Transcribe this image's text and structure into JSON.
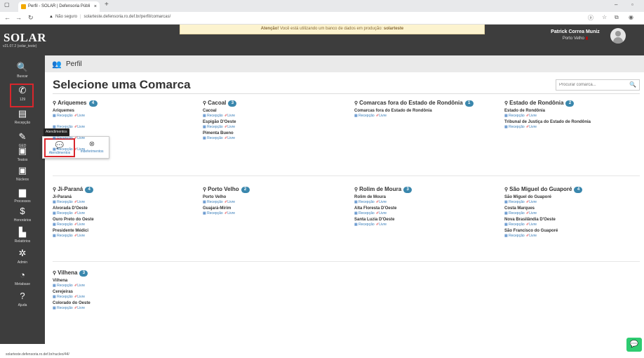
{
  "browser": {
    "tab_title": "Perfil - SOLAR | Defensoria Públi",
    "tab_close": "×",
    "new_tab": "+",
    "security_label": "Não seguro",
    "url": "solarteste.defensoria.ro.def.br/perfil/comarcas/",
    "status_url": "solarteste.defensoria.ro.def.br/nucleo/44/"
  },
  "app": {
    "logo": "SOLAR",
    "version": "v21.07.2 (solar_teste)",
    "alert_prefix": "Atenção!",
    "alert_text": "Você está utilizando um banco de dados em produção:",
    "alert_db": "solarteste",
    "user_name": "Patrick Correa Muniz",
    "user_location": "Porto Velho"
  },
  "sidebar": [
    {
      "label": "Buscar",
      "icon": "search-icon",
      "glyph": "🔍"
    },
    {
      "label": "129",
      "icon": "phone-icon",
      "glyph": "✆"
    },
    {
      "label": "Recepção",
      "icon": "reception-icon",
      "glyph": "▤"
    },
    {
      "label": "GED",
      "icon": "ged-icon",
      "glyph": "✎"
    },
    {
      "label": "Teatos",
      "icon": "building-icon",
      "glyph": "▣"
    },
    {
      "label": "Núcleos",
      "icon": "institution-icon",
      "glyph": "▣"
    },
    {
      "label": "Processos",
      "icon": "folder-icon",
      "glyph": "▆"
    },
    {
      "label": "Honorários",
      "icon": "money-icon",
      "glyph": "$"
    },
    {
      "label": "Relatórios",
      "icon": "chart-icon",
      "glyph": "▙"
    },
    {
      "label": "Admin",
      "icon": "cogs-icon",
      "glyph": "✲"
    },
    {
      "label": "Metabase",
      "icon": "pie-icon",
      "glyph": "◔"
    },
    {
      "label": "Ajuda",
      "icon": "help-icon",
      "glyph": "?"
    }
  ],
  "tooltip": "Atendimentos",
  "popover": {
    "option1": "Atendimentos",
    "option2": "Indeferimentos"
  },
  "page": {
    "header": "Perfil",
    "title": "Selecione uma Comarca",
    "search_placeholder": "Procurar comarca..."
  },
  "links": {
    "reception": "Recepção",
    "free": "Livre"
  },
  "groups": [
    {
      "name": "Ariquemes",
      "count": "4",
      "entries": [
        "Ariquemes",
        "",
        "",
        ""
      ]
    },
    {
      "name": "Cacoal",
      "count": "3",
      "entries": [
        "Cacoal",
        "Espigão D'Oeste",
        "Pimenta Bueno"
      ]
    },
    {
      "name": "Comarcas fora do Estado de Rondônia",
      "count": "1",
      "entries": [
        "Comarcas fora do Estado de Rondônia"
      ]
    },
    {
      "name": "Estado de Rondônia",
      "count": "2",
      "entries": [
        "Estado de Rondônia",
        "Tribunal de Justiça do Estado de Rondônia"
      ]
    },
    {
      "name": "Ji-Paraná",
      "count": "4",
      "entries": [
        "Ji-Paraná",
        "Alvorada D'Oeste",
        "Ouro Preto do Oeste",
        "Presidente Médici"
      ]
    },
    {
      "name": "Porto Velho",
      "count": "2",
      "entries": [
        "Porto Velho",
        "Guajará-Mirim"
      ]
    },
    {
      "name": "Rolim de Moura",
      "count": "3",
      "entries": [
        "Rolim de Moura",
        "Alta Floresta D'Oeste",
        "Santa Luzia D'Oeste"
      ]
    },
    {
      "name": "São Miguel do Guaporé",
      "count": "4",
      "entries": [
        "São Miguel do Guaporé",
        "Costa Marques",
        "Nova Brasilândia D'Oeste",
        "São Francisco do Guaporé"
      ]
    },
    {
      "name": "Vilhena",
      "count": "3",
      "entries": [
        "Vilhena",
        "Cerejeiras",
        "Colorado do Oeste"
      ]
    }
  ]
}
